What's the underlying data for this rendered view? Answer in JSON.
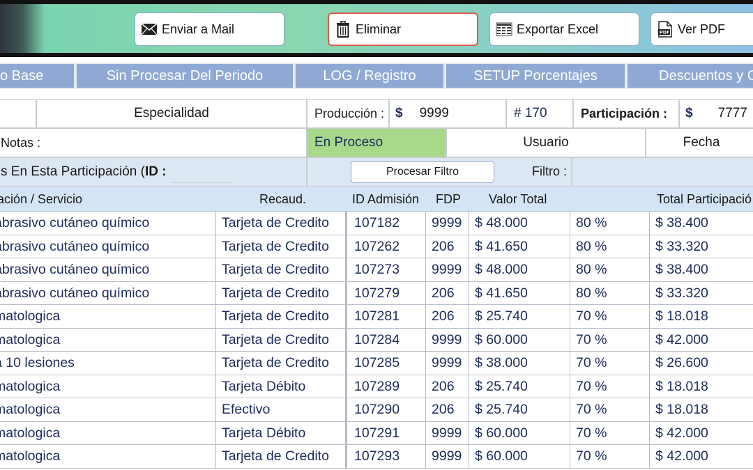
{
  "toolbar": {
    "mail_label": "Enviar a Mail",
    "delete_label": "Eliminar",
    "excel_label": "Exportar Excel",
    "pdf_label": "Ver PDF"
  },
  "tabs": [
    "o Base",
    "Sin Procesar Del Periodo",
    "LOG / Registro",
    "SETUP Porcentajes",
    "Descuentos y C"
  ],
  "header": {
    "especialidad": "Especialidad",
    "produccion_label": "Producción :",
    "produccion_currency": "$",
    "produccion_value": "9999",
    "numero": "# 170",
    "participacion_label": "Participación :",
    "participacion_currency": "$",
    "participacion_value": "7777",
    "notas_label": "Notas :",
    "estado": "En Proceso",
    "usuario": "Usuario",
    "fecha": "Fecha",
    "titulo_prefix": "s En Esta Participación (",
    "titulo_id": "ID :",
    "procesar_filtro": "Procesar Filtro",
    "filtro_label": "Filtro :"
  },
  "columns": [
    "ación / Servicio",
    "Recaud.",
    "ID Admisión",
    "FDP",
    "Valor Total",
    "Total Participació"
  ],
  "rows": [
    {
      "servicio": "abrasivo cutáneo químico",
      "recaud": "Tarjeta de Credito",
      "id": "107182",
      "fdp": "9999",
      "valor": "$ 48.000",
      "pct": "80 %",
      "total": "$ 38.400"
    },
    {
      "servicio": "abrasivo cutáneo químico",
      "recaud": "Tarjeta de Credito",
      "id": "107262",
      "fdp": "206",
      "valor": "$ 41.650",
      "pct": "80 %",
      "total": "$ 33.320"
    },
    {
      "servicio": "abrasivo cutáneo químico",
      "recaud": "Tarjeta de Credito",
      "id": "107273",
      "fdp": "9999",
      "valor": "$ 48.000",
      "pct": "80 %",
      "total": "$ 38.400"
    },
    {
      "servicio": "abrasivo cutáneo químico",
      "recaud": "Tarjeta de Credito",
      "id": "107279",
      "fdp": "206",
      "valor": "$ 41.650",
      "pct": "80 %",
      "total": "$ 33.320"
    },
    {
      "servicio": "matologica",
      "recaud": "Tarjeta de Credito",
      "id": "107281",
      "fdp": "206",
      "valor": "$ 25.740",
      "pct": "70 %",
      "total": "$ 18.018"
    },
    {
      "servicio": "matologica",
      "recaud": "Tarjeta de Credito",
      "id": "107284",
      "fdp": "9999",
      "valor": "$ 60.000",
      "pct": "70 %",
      "total": "$ 42.000"
    },
    {
      "servicio": " a 10 lesiones",
      "recaud": "Tarjeta de Credito",
      "id": "107285",
      "fdp": "9999",
      "valor": "$ 38.000",
      "pct": "70 %",
      "total": "$ 26.600"
    },
    {
      "servicio": "matologica",
      "recaud": "Tarjeta Débito",
      "id": "107289",
      "fdp": "206",
      "valor": "$ 25.740",
      "pct": "70 %",
      "total": "$ 18.018"
    },
    {
      "servicio": "matologica",
      "recaud": "Efectivo",
      "id": "107290",
      "fdp": "206",
      "valor": "$ 25.740",
      "pct": "70 %",
      "total": "$ 18.018"
    },
    {
      "servicio": "matologica",
      "recaud": "Tarjeta Débito",
      "id": "107291",
      "fdp": "9999",
      "valor": "$ 60.000",
      "pct": "70 %",
      "total": "$ 42.000"
    },
    {
      "servicio": "matologica",
      "recaud": "Tarjeta de Credito",
      "id": "107293",
      "fdp": "9999",
      "valor": "$ 60.000",
      "pct": "70 %",
      "total": "$ 42.000"
    }
  ],
  "colors": {
    "tab_bg": "#8fa9d4",
    "estado_bg": "#a8d98a",
    "row_text": "#1d2c5c",
    "thead_bg": "#d4e4f6"
  }
}
